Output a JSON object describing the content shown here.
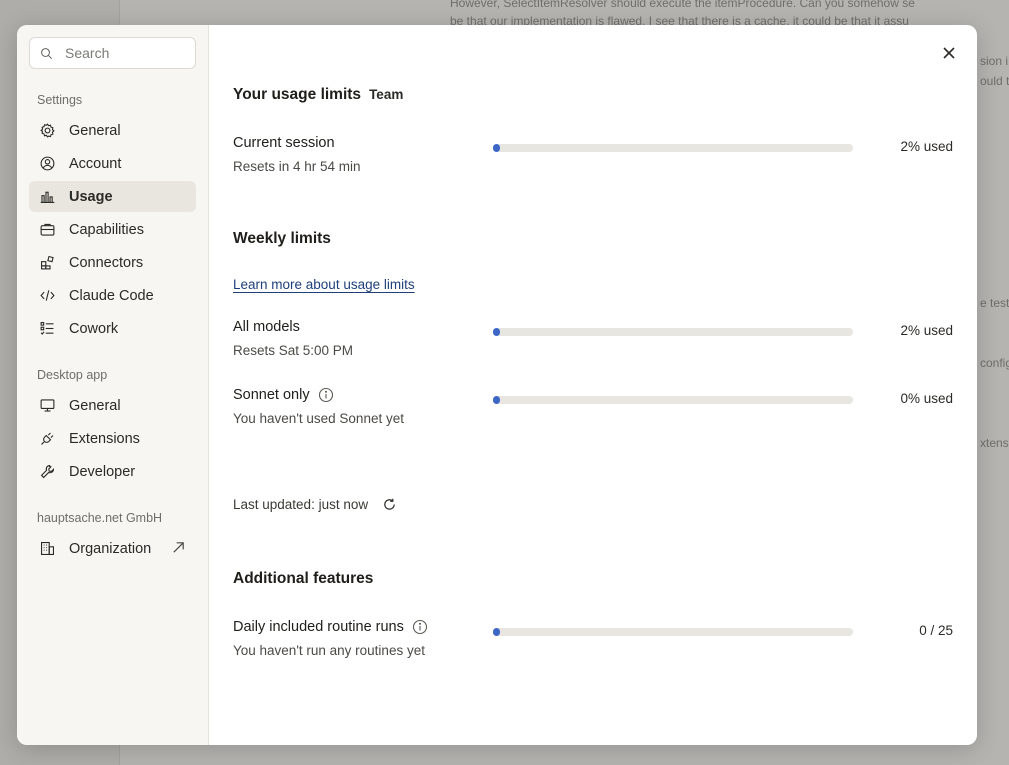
{
  "background": {
    "lines": [
      "However, SelectItemResolver should execute the itemProcedure. Can you somehow se",
      "be that our implementation is flawed. I see that there is a cache, it could be that it assu",
      "sion i",
      "ould t",
      "e test",
      "config",
      "xtens"
    ]
  },
  "sidebar": {
    "search_placeholder": "Search",
    "settings_label": "Settings",
    "settings_items": [
      {
        "label": "General",
        "icon": "gear-icon"
      },
      {
        "label": "Account",
        "icon": "user-circle-icon"
      },
      {
        "label": "Usage",
        "icon": "bar-chart-icon",
        "active": true
      },
      {
        "label": "Capabilities",
        "icon": "briefcase-icon"
      },
      {
        "label": "Connectors",
        "icon": "puzzle-blocks-icon"
      },
      {
        "label": "Claude Code",
        "icon": "code-icon"
      },
      {
        "label": "Cowork",
        "icon": "checklist-icon"
      }
    ],
    "desktop_label": "Desktop app",
    "desktop_items": [
      {
        "label": "General",
        "icon": "monitor-icon"
      },
      {
        "label": "Extensions",
        "icon": "plug-icon"
      },
      {
        "label": "Developer",
        "icon": "wrench-icon"
      }
    ],
    "org_label": "hauptsache.net GmbH",
    "org_items": [
      {
        "label": "Organization",
        "icon": "building-icon"
      }
    ]
  },
  "main": {
    "title": "Your usage limits",
    "plan_badge": "Team",
    "session": {
      "label": "Current session",
      "sub": "Resets in 4 hr 54 min",
      "value": "2% used",
      "fraction": 0.02
    },
    "weekly_title": "Weekly limits",
    "learn_more": "Learn more about usage limits",
    "all_models": {
      "label": "All models",
      "sub": "Resets Sat 5:00 PM",
      "value": "2% used",
      "fraction": 0.02
    },
    "sonnet": {
      "label": "Sonnet only",
      "sub": "You haven't used Sonnet yet",
      "value": "0% used",
      "fraction": 0.0
    },
    "last_updated": "Last updated: just now",
    "additional_title": "Additional features",
    "routines": {
      "label": "Daily included routine runs",
      "sub": "You haven't run any routines yet",
      "value": "0 / 25",
      "fraction": 0.0
    }
  },
  "colors": {
    "accent": "#3e66c7",
    "track": "#e8e6e1",
    "active_nav": "#e8e6df"
  }
}
